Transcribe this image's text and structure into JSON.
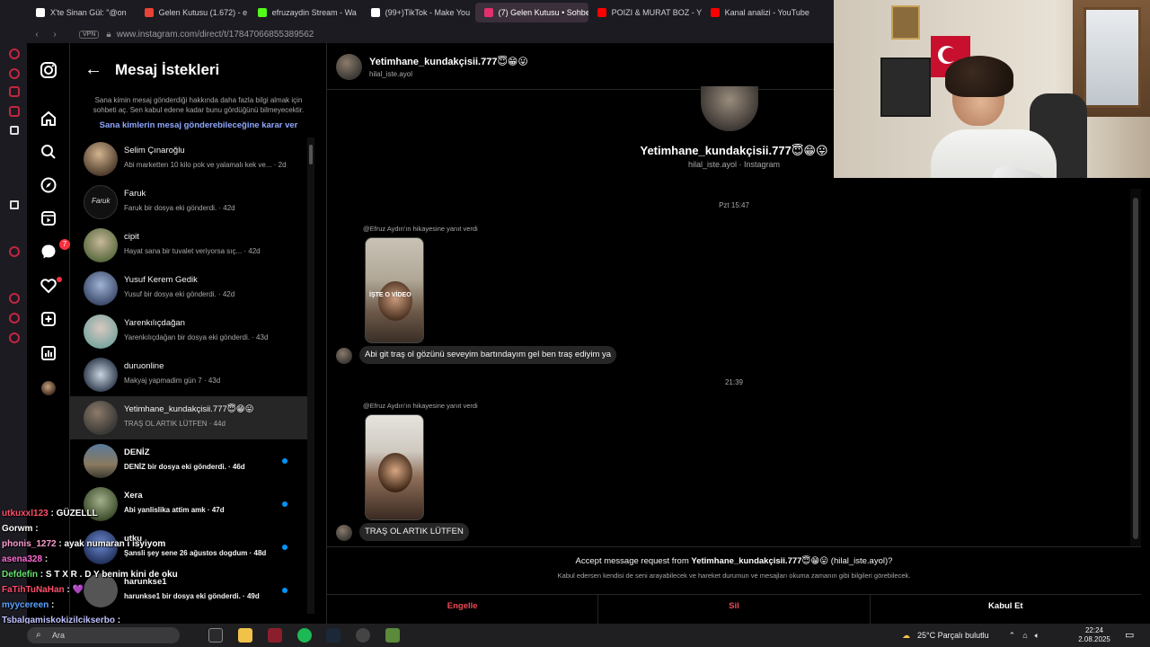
{
  "browser": {
    "tabs": [
      {
        "label": "X'te Sinan Gül: \"@on",
        "color": "#ffffff",
        "icon": "x-logo-icon"
      },
      {
        "label": "Gelen Kutusu (1.672) - e",
        "color": "#ea4335",
        "icon": "gmail-icon"
      },
      {
        "label": "efruzaydin Stream - Wa",
        "color": "#53fc18",
        "icon": "kick-icon"
      },
      {
        "label": "(99+)TikTok - Make You",
        "color": "#ffffff",
        "icon": "tiktok-icon"
      },
      {
        "label": "(7) Gelen Kutusu • Sohbe",
        "color": "#e1306c",
        "icon": "instagram-icon",
        "active": true
      },
      {
        "label": "POIZI & MURAT BOZ - Y",
        "color": "#ff0000",
        "icon": "youtube-icon"
      },
      {
        "label": "Kanal analizi - YouTube",
        "color": "#ff0000",
        "icon": "youtube-icon"
      }
    ],
    "url": "www.instagram.com/direct/t/17847066855389562",
    "vpn_label": "VPN"
  },
  "requests": {
    "title": "Mesaj İstekleri",
    "info": "Sana kimin mesaj gönderdiği hakkında daha fazla bilgi almak için sohbeti aç. Sen kabul edene kadar bunu gördüğünü bilmeyecektir.",
    "link": "Sana kimlerin mesaj gönderebileceğine karar ver",
    "items": [
      {
        "name": "Selim Çınaroğlu",
        "snippet": "Abi marketten 10 kilo pok ve yalamalı kek ve...",
        "time": "2d",
        "unread": false
      },
      {
        "name": "Faruk",
        "snippet": "Faruk bir dosya eki gönderdi.",
        "time": "42d",
        "unread": false
      },
      {
        "name": "cipit",
        "snippet": "Hayat sana bir tuvalet veriyorsa sıç...",
        "time": "42d",
        "unread": false
      },
      {
        "name": "Yusuf Kerem Gedik",
        "snippet": "Yusuf bir dosya eki gönderdi.",
        "time": "42d",
        "unread": false
      },
      {
        "name": "Yarenkılıçdağan",
        "snippet": "Yarenkılıçdağan bir dosya eki gönderdi.",
        "time": "43d",
        "unread": false
      },
      {
        "name": "duruonline",
        "snippet": "Makyaj yapmadim gün 7",
        "time": "43d",
        "unread": false
      },
      {
        "name": "Yetimhane_kundakçisii.777😇😁😛",
        "snippet": "TRAŞ OL ARTIK LÜTFEN",
        "time": "44d",
        "unread": false,
        "active": true
      },
      {
        "name": "DENİZ",
        "snippet": "DENİZ bir dosya eki gönderdi.",
        "time": "46d",
        "unread": true
      },
      {
        "name": "Xera",
        "snippet": "Abi yanlislika attim amk",
        "time": "47d",
        "unread": true
      },
      {
        "name": "utku",
        "snippet": "Şansli şey sene 26 ağustos dogdum",
        "time": "48d",
        "unread": true
      },
      {
        "name": "harunkse1",
        "snippet": "harunkse1 bir dosya eki gönderdi.",
        "time": "49d",
        "unread": true
      }
    ]
  },
  "chat": {
    "header_name": "Yetimhane_kundakçisii.777😇😁😛",
    "header_user": "hilal_iste.ayol",
    "profile_name": "Yetimhane_kundakçisii.777😇😁😛",
    "profile_sub": "hilal_iste.ayol · Instagram",
    "messages": [
      {
        "timestamp": "Pzt 15:47",
        "story_note": "@Efruz Aydın'ın hikayesine yanıt verdi",
        "story_caption": "İŞTE O VİDEO",
        "text": "Abi git traş ol gözünü seveyim bartındayım gel ben traş ediyim ya"
      },
      {
        "timestamp": "21:39",
        "story_note": "@Efruz Aydın'ın hikayesine yanıt verdi",
        "story_caption": "",
        "text": "TRAŞ OL ARTIK LÜTFEN"
      }
    ],
    "accept_prefix": "Accept message request from",
    "accept_name": "Yetimhane_kundakçisii.777😇😁😛",
    "accept_suffix": "(hilal_iste.ayol)?",
    "accept_sub": "Kabul edersen kendisi de seni arayabilecek ve hareket durumun ve mesajları okuma zamanın gibi bilgileri görebilecek.",
    "actions": {
      "block": "Engelle",
      "delete": "Sil",
      "accept": "Kabul Et"
    }
  },
  "nav_badge": "7",
  "twitch_chat": [
    {
      "user": "utkuxxl123",
      "message": "GÜZELLL",
      "color": "#ff4f6a"
    },
    {
      "user": "Gorwm",
      "message": "",
      "color": "#ffffff"
    },
    {
      "user": "phonis_1272",
      "message": "ayak numaran ı isyiyom",
      "color": "#ff9bd0"
    },
    {
      "user": "asena328",
      "message": "",
      "color": "#ff6bd6"
    },
    {
      "user": "Defdefin",
      "message": "S T X R . D Y benim kini de oku",
      "color": "#66e06b"
    },
    {
      "user": "FaTihTuNaHan",
      "message": "💜",
      "color": "#ff4f6a"
    },
    {
      "user": "myycereen",
      "message": "",
      "color": "#5aa2ff"
    },
    {
      "user": "Tsbalgamiskokizilcikserbo",
      "message": "",
      "color": "#c0c0ff"
    }
  ],
  "taskbar": {
    "search": "Ara",
    "weather": "25°C  Parçalı bulutlu",
    "time": "22:24",
    "date": "2.08.2025"
  }
}
